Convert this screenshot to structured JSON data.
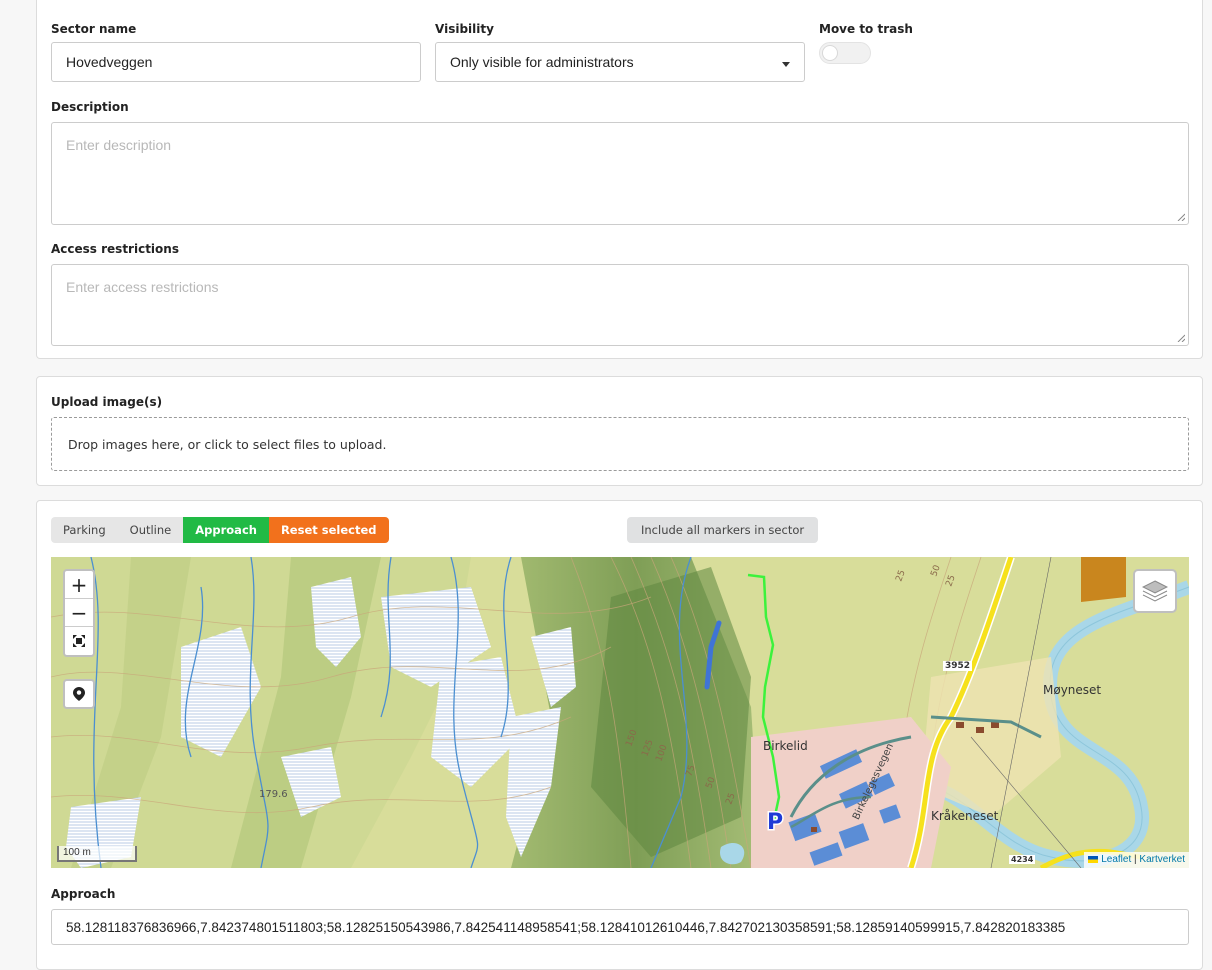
{
  "form": {
    "sector_name": {
      "label": "Sector name",
      "value": "Hovedveggen"
    },
    "visibility": {
      "label": "Visibility",
      "value": "Only visible for administrators"
    },
    "trash": {
      "label": "Move to trash",
      "checked": false
    },
    "description": {
      "label": "Description",
      "placeholder": "Enter description",
      "value": ""
    },
    "access": {
      "label": "Access restrictions",
      "placeholder": "Enter access restrictions",
      "value": ""
    }
  },
  "upload": {
    "label": "Upload image(s)",
    "dropzone_text": "Drop images here, or click to select files to upload."
  },
  "map_tools": {
    "modes": [
      {
        "label": "Parking",
        "active": false
      },
      {
        "label": "Outline",
        "active": false
      },
      {
        "label": "Approach",
        "active": true,
        "color": "#21ba45"
      },
      {
        "label": "Reset selected",
        "color": "#f2711c"
      }
    ],
    "include_all_label": "Include all markers in sector"
  },
  "map": {
    "zoom_in": "+",
    "zoom_out": "−",
    "scale_label": "100 m",
    "attribution_leaflet": "Leaflet",
    "attribution_sep": "|",
    "attribution_source": "Kartverket",
    "place_labels": {
      "birkelid": "Birkelid",
      "moyneset": "Møyneset",
      "krakeneset": "Kråkeneset",
      "road_3952": "3952",
      "elev_179": "179.6",
      "road_name": "Birkelegesvegen",
      "road_4234": "4234"
    },
    "contour_labels": [
      "150",
      "125",
      "100",
      "75",
      "50",
      "25",
      "25",
      "50",
      "25"
    ],
    "colors": {
      "approach_line": "#3cf23c",
      "parking_marker": "#1f3bd6",
      "route_blue": "#3f74d6"
    }
  },
  "approach": {
    "label": "Approach",
    "value": "58.128118376836966,7.842374801511803;58.12825150543986,7.842541148958541;58.12841012610446,7.842702130358591;58.12859140599915,7.842820183385"
  }
}
